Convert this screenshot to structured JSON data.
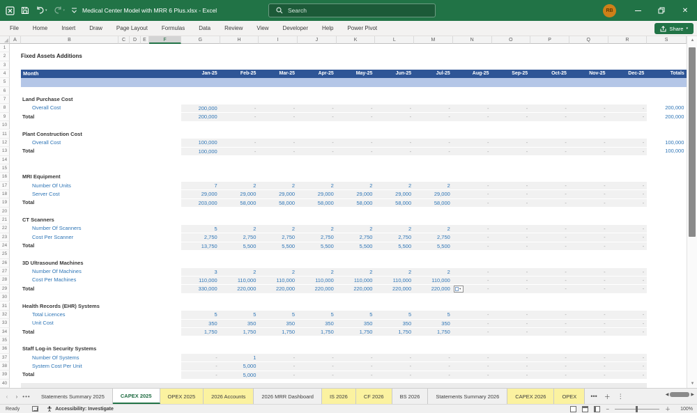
{
  "titlebar": {
    "title": "Medical Center Model with MRR 6 Plus.xlsx  -  Excel",
    "search_placeholder": "Search",
    "avatar_initials": "RB"
  },
  "ribbon": {
    "tabs": [
      "File",
      "Home",
      "Insert",
      "Draw",
      "Page Layout",
      "Formulas",
      "Data",
      "Review",
      "View",
      "Developer",
      "Help",
      "Power Pivot"
    ],
    "share_label": "Share"
  },
  "grid": {
    "column_letters": [
      "A",
      "B",
      "C",
      "D",
      "E",
      "F",
      "G",
      "H",
      "I",
      "J",
      "K",
      "L",
      "M",
      "N",
      "O",
      "P",
      "Q",
      "R",
      "S"
    ],
    "selected_column": "F",
    "month_columns": [
      "G",
      "H",
      "I",
      "J",
      "K",
      "L",
      "M",
      "N",
      "O",
      "P",
      "Q",
      "R"
    ],
    "header": {
      "month_label": "Month",
      "months": [
        "Jan-25",
        "Feb-25",
        "Mar-25",
        "Apr-25",
        "May-25",
        "Jun-25",
        "Jul-25",
        "Aug-25",
        "Sep-25",
        "Oct-25",
        "Nov-25",
        "Dec-25"
      ],
      "totals_label": "Totals"
    },
    "rows": [
      {
        "n": 1,
        "type": "blank"
      },
      {
        "n": 2,
        "type": "title",
        "label": "Fixed Assets Additions"
      },
      {
        "n": 3,
        "type": "blank"
      },
      {
        "n": 4,
        "type": "header"
      },
      {
        "n": 5,
        "type": "band"
      },
      {
        "n": 6,
        "type": "blank"
      },
      {
        "n": 7,
        "type": "section",
        "label": "Land Purchase Cost"
      },
      {
        "n": 8,
        "type": "input",
        "label": "Overall Cost",
        "values": [
          "200,000",
          "-",
          "-",
          "-",
          "-",
          "-",
          "-",
          "-",
          "-",
          "-",
          "-",
          "-"
        ],
        "total": "200,000"
      },
      {
        "n": 9,
        "type": "total",
        "label": "Total",
        "values": [
          "200,000",
          "-",
          "-",
          "-",
          "-",
          "-",
          "-",
          "-",
          "-",
          "-",
          "-",
          "-"
        ],
        "total": "200,000"
      },
      {
        "n": 10,
        "type": "blank"
      },
      {
        "n": 11,
        "type": "section",
        "label": "Plant Construction Cost"
      },
      {
        "n": 12,
        "type": "input",
        "label": "Overall Cost",
        "values": [
          "100,000",
          "-",
          "-",
          "-",
          "-",
          "-",
          "-",
          "-",
          "-",
          "-",
          "-",
          "-"
        ],
        "total": "100,000"
      },
      {
        "n": 13,
        "type": "total",
        "label": "Total",
        "values": [
          "100,000",
          "-",
          "-",
          "-",
          "-",
          "-",
          "-",
          "-",
          "-",
          "-",
          "-",
          "-"
        ],
        "total": "100,000"
      },
      {
        "n": 14,
        "type": "blank"
      },
      {
        "n": 15,
        "type": "blank"
      },
      {
        "n": 16,
        "type": "section",
        "label": "MRI Equipment"
      },
      {
        "n": 17,
        "type": "input",
        "label": "Number Of Units",
        "values": [
          "7",
          "2",
          "2",
          "2",
          "2",
          "2",
          "2",
          "-",
          "-",
          "-",
          "-",
          "-"
        ],
        "total": ""
      },
      {
        "n": 18,
        "type": "input",
        "label": "Server Cost",
        "values": [
          "29,000",
          "29,000",
          "29,000",
          "29,000",
          "29,000",
          "29,000",
          "29,000",
          "-",
          "-",
          "-",
          "-",
          "-"
        ],
        "total": ""
      },
      {
        "n": 19,
        "type": "total",
        "label": "Total",
        "values": [
          "203,000",
          "58,000",
          "58,000",
          "58,000",
          "58,000",
          "58,000",
          "58,000",
          "-",
          "-",
          "-",
          "-",
          "-"
        ],
        "total": ""
      },
      {
        "n": 20,
        "type": "blank"
      },
      {
        "n": 21,
        "type": "section",
        "label": "CT Scanners"
      },
      {
        "n": 22,
        "type": "input",
        "label": "Number Of Scanners",
        "values": [
          "5",
          "2",
          "2",
          "2",
          "2",
          "2",
          "2",
          "-",
          "-",
          "-",
          "-",
          "-"
        ],
        "total": ""
      },
      {
        "n": 23,
        "type": "input",
        "label": "Cost Per Scanner",
        "values": [
          "2,750",
          "2,750",
          "2,750",
          "2,750",
          "2,750",
          "2,750",
          "2,750",
          "-",
          "-",
          "-",
          "-",
          "-"
        ],
        "total": ""
      },
      {
        "n": 24,
        "type": "total",
        "label": "Total",
        "values": [
          "13,750",
          "5,500",
          "5,500",
          "5,500",
          "5,500",
          "5,500",
          "5,500",
          "-",
          "-",
          "-",
          "-",
          "-"
        ],
        "total": ""
      },
      {
        "n": 25,
        "type": "blank"
      },
      {
        "n": 26,
        "type": "section",
        "label": "3D Ultrasound Machines"
      },
      {
        "n": 27,
        "type": "input",
        "label": "Number Of Machines",
        "values": [
          "3",
          "2",
          "2",
          "2",
          "2",
          "2",
          "2",
          "-",
          "-",
          "-",
          "-",
          "-"
        ],
        "total": ""
      },
      {
        "n": 28,
        "type": "input",
        "label": "Cost Per Machines",
        "values": [
          "110,000",
          "110,000",
          "110,000",
          "110,000",
          "110,000",
          "110,000",
          "110,000",
          "-",
          "-",
          "-",
          "-",
          "-"
        ],
        "total": ""
      },
      {
        "n": 29,
        "type": "total",
        "label": "Total",
        "values": [
          "330,000",
          "220,000",
          "220,000",
          "220,000",
          "220,000",
          "220,000",
          "220,000",
          "-",
          "-",
          "-",
          "-",
          "-"
        ],
        "total": "",
        "autofill": true
      },
      {
        "n": 30,
        "type": "blank"
      },
      {
        "n": 31,
        "type": "section",
        "label": "Health Records (EHR) Systems"
      },
      {
        "n": 32,
        "type": "input",
        "label": "Total Licences",
        "values": [
          "5",
          "5",
          "5",
          "5",
          "5",
          "5",
          "5",
          "-",
          "-",
          "-",
          "-",
          "-"
        ],
        "total": ""
      },
      {
        "n": 33,
        "type": "input",
        "label": "Unit Cost",
        "values": [
          "350",
          "350",
          "350",
          "350",
          "350",
          "350",
          "350",
          "-",
          "-",
          "-",
          "-",
          "-"
        ],
        "total": ""
      },
      {
        "n": 34,
        "type": "total",
        "label": "Total",
        "values": [
          "1,750",
          "1,750",
          "1,750",
          "1,750",
          "1,750",
          "1,750",
          "1,750",
          "-",
          "-",
          "-",
          "-",
          "-"
        ],
        "total": ""
      },
      {
        "n": 35,
        "type": "blank"
      },
      {
        "n": 36,
        "type": "section",
        "label": "Staff Log-in Security Systems"
      },
      {
        "n": 37,
        "type": "input",
        "label": "Number Of Systems",
        "values": [
          "-",
          "1",
          "-",
          "-",
          "-",
          "-",
          "-",
          "-",
          "-",
          "-",
          "-",
          "-"
        ],
        "total": ""
      },
      {
        "n": 38,
        "type": "input",
        "label": "System Cost Per Unit",
        "values": [
          "-",
          "5,000",
          "-",
          "-",
          "-",
          "-",
          "-",
          "-",
          "-",
          "-",
          "-",
          "-"
        ],
        "total": ""
      },
      {
        "n": 39,
        "type": "total",
        "label": "Total",
        "values": [
          "-",
          "5,000",
          "-",
          "-",
          "-",
          "-",
          "-",
          "-",
          "-",
          "-",
          "-",
          "-"
        ],
        "total": ""
      },
      {
        "n": 40,
        "type": "partial"
      }
    ]
  },
  "sheet_tabs": {
    "tabs": [
      {
        "label": "Statements Summary 2025",
        "style": "normal"
      },
      {
        "label": "CAPEX 2025",
        "style": "active"
      },
      {
        "label": "OPEX 2025",
        "style": "yellow"
      },
      {
        "label": "2026 Accounts",
        "style": "yellow"
      },
      {
        "label": "2026 MRR Dashboard",
        "style": "normal"
      },
      {
        "label": "IS 2026",
        "style": "yellow"
      },
      {
        "label": "CF 2026",
        "style": "yellow"
      },
      {
        "label": "BS 2026",
        "style": "normal"
      },
      {
        "label": "Statements Summary 2026",
        "style": "normal"
      },
      {
        "label": "CAPEX 2026",
        "style": "yellow"
      },
      {
        "label": "OPEX",
        "style": "yellow"
      }
    ]
  },
  "status_bar": {
    "ready_label": "Ready",
    "accessibility_label": "Accessibility: Investigate",
    "zoom_level": "100%"
  },
  "colors": {
    "excel_green": "#217346",
    "table_header_blue": "#2E5596",
    "band_blue": "#B4C6E7",
    "value_blue": "#2E75B6",
    "tab_yellow": "#FBF2A0"
  }
}
